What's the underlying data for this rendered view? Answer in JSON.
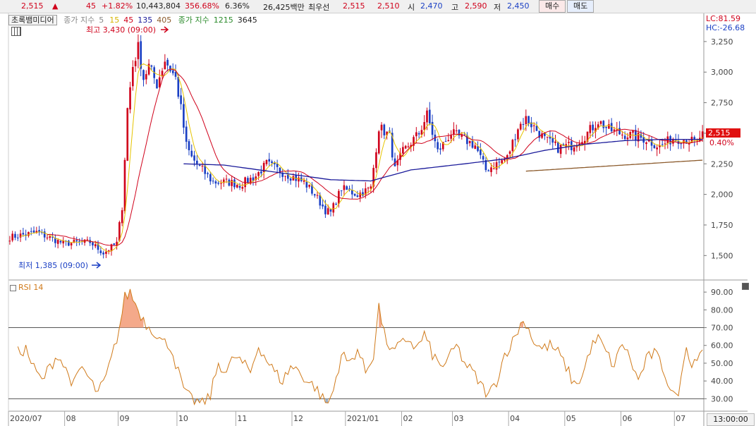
{
  "header": {
    "price": "2,515",
    "change_arrow": "▲",
    "change": "45",
    "change_pct": "+1.82%",
    "volume": "10,443,804",
    "vol_ratio": "356.68%",
    "turnover": "6.36%",
    "amount": "26,425백만",
    "best_bid_label": "최우선",
    "best_ask": "2,515",
    "best_bid": "2,510",
    "open_label": "시",
    "open": "2,470",
    "high_label": "고",
    "high": "2,590",
    "low_label": "저",
    "low": "2,450",
    "buy_button": "매수",
    "sell_button": "매도"
  },
  "legend": {
    "source": "초록뱀미디어",
    "ma_label": "종가 지수",
    "ma_periods": [
      "5",
      "15",
      "45",
      "135",
      "405"
    ],
    "ma2_label": "종가 지수",
    "ma2_periods": [
      "1215",
      "3645"
    ]
  },
  "side": {
    "lc": "LC:81.59",
    "hc": "HC:-26.68",
    "last_price": "2,515",
    "last_pct": "0.40%",
    "time": "13:00:00"
  },
  "annotations": {
    "high": "최고 3,430 (09:00)",
    "low": "최저 1,385 (09:00)"
  },
  "rsi_title": "RSI 14",
  "colors": {
    "up": "#d0021b",
    "down": "#1a3fc4",
    "ma5": "#e6c400",
    "ma15": "#d0021b",
    "ma45": "#1a1a9a",
    "ma135": "#8b5a2b",
    "rsi": "#d07a1a"
  },
  "chart_data": [
    {
      "type": "candlestick",
      "ylim": [
        1300,
        3480
      ],
      "yticks": [
        1500,
        1750,
        2000,
        2250,
        2500,
        2750,
        3000,
        3250
      ],
      "ytick_labels": [
        "1,500",
        "1,750",
        "2,000",
        "2,250",
        "2,500",
        "2,750",
        "3,000",
        "3,250"
      ],
      "x_labels": [
        "2020/07",
        "08",
        "09",
        "10",
        "11",
        "12",
        "2021/01",
        "02",
        "03",
        "04",
        "05",
        "06",
        "07"
      ],
      "x_label_positions": [
        0,
        21,
        41,
        63,
        85,
        106,
        126,
        147,
        166,
        187,
        208,
        229,
        249
      ],
      "n_bars": 260,
      "close_anchors": [
        [
          0,
          1650
        ],
        [
          10,
          1690
        ],
        [
          20,
          1600
        ],
        [
          30,
          1610
        ],
        [
          35,
          1520
        ],
        [
          40,
          1600
        ],
        [
          42,
          1900
        ],
        [
          44,
          2700
        ],
        [
          46,
          3050
        ],
        [
          48,
          3200
        ],
        [
          50,
          2950
        ],
        [
          52,
          3050
        ],
        [
          55,
          2900
        ],
        [
          58,
          3100
        ],
        [
          62,
          2950
        ],
        [
          64,
          2700
        ],
        [
          66,
          2400
        ],
        [
          68,
          2300
        ],
        [
          72,
          2200
        ],
        [
          76,
          2100
        ],
        [
          82,
          2100
        ],
        [
          86,
          2080
        ],
        [
          92,
          2150
        ],
        [
          96,
          2250
        ],
        [
          102,
          2180
        ],
        [
          110,
          2100
        ],
        [
          114,
          2000
        ],
        [
          118,
          1870
        ],
        [
          120,
          1850
        ],
        [
          124,
          2050
        ],
        [
          130,
          2000
        ],
        [
          135,
          2050
        ],
        [
          138,
          2550
        ],
        [
          142,
          2480
        ],
        [
          144,
          2200
        ],
        [
          147,
          2350
        ],
        [
          153,
          2500
        ],
        [
          156,
          2650
        ],
        [
          160,
          2350
        ],
        [
          165,
          2500
        ],
        [
          170,
          2450
        ],
        [
          174,
          2400
        ],
        [
          178,
          2200
        ],
        [
          182,
          2250
        ],
        [
          186,
          2300
        ],
        [
          190,
          2550
        ],
        [
          193,
          2620
        ],
        [
          196,
          2550
        ],
        [
          200,
          2450
        ],
        [
          205,
          2380
        ],
        [
          210,
          2400
        ],
        [
          215,
          2480
        ],
        [
          220,
          2600
        ],
        [
          224,
          2530
        ],
        [
          228,
          2500
        ],
        [
          233,
          2480
        ],
        [
          238,
          2450
        ],
        [
          243,
          2390
        ],
        [
          248,
          2460
        ],
        [
          253,
          2450
        ],
        [
          257,
          2420
        ],
        [
          259,
          2515
        ]
      ],
      "ma135_anchors": [
        [
          65,
          2250
        ],
        [
          80,
          2240
        ],
        [
          100,
          2180
        ],
        [
          120,
          2120
        ],
        [
          135,
          2110
        ],
        [
          150,
          2200
        ],
        [
          170,
          2250
        ],
        [
          185,
          2290
        ],
        [
          200,
          2360
        ],
        [
          215,
          2410
        ],
        [
          230,
          2440
        ],
        [
          245,
          2450
        ],
        [
          259,
          2450
        ]
      ],
      "ma405_anchors": [
        [
          193,
          2190
        ],
        [
          259,
          2280
        ]
      ],
      "series": [
        {
          "name": "5",
          "type": "line"
        },
        {
          "name": "15",
          "type": "line"
        },
        {
          "name": "45",
          "type": "line"
        },
        {
          "name": "135",
          "type": "line"
        },
        {
          "name": "405",
          "type": "line"
        }
      ]
    },
    {
      "type": "line",
      "ylim": [
        23,
        96
      ],
      "yticks": [
        30,
        40,
        50,
        60,
        70,
        80,
        90
      ],
      "ytick_labels": [
        "30.00",
        "40.00",
        "50.00",
        "60.00",
        "70.00",
        "80.00",
        "90.00"
      ],
      "overbought": 70,
      "oversold": 30,
      "series": [
        {
          "name": "RSI 14",
          "anchors": [
            [
              3,
              56
            ],
            [
              6,
              58
            ],
            [
              9,
              47
            ],
            [
              12,
              40
            ],
            [
              15,
              48
            ],
            [
              18,
              55
            ],
            [
              21,
              46
            ],
            [
              24,
              38
            ],
            [
              27,
              48
            ],
            [
              30,
              40
            ],
            [
              33,
              33
            ],
            [
              36,
              42
            ],
            [
              39,
              58
            ],
            [
              41,
              70
            ],
            [
              43,
              87
            ],
            [
              45,
              90
            ],
            [
              48,
              80
            ],
            [
              51,
              72
            ],
            [
              54,
              68
            ],
            [
              57,
              62
            ],
            [
              60,
              60
            ],
            [
              62,
              50
            ],
            [
              64,
              40
            ],
            [
              66,
              32
            ],
            [
              69,
              29
            ],
            [
              72,
              27
            ],
            [
              75,
              32
            ],
            [
              78,
              50
            ],
            [
              81,
              45
            ],
            [
              84,
              54
            ],
            [
              87,
              50
            ],
            [
              90,
              45
            ],
            [
              93,
              60
            ],
            [
              96,
              52
            ],
            [
              99,
              45
            ],
            [
              102,
              40
            ],
            [
              105,
              48
            ],
            [
              108,
              46
            ],
            [
              111,
              40
            ],
            [
              114,
              37
            ],
            [
              117,
              30
            ],
            [
              119,
              27
            ],
            [
              121,
              35
            ],
            [
              124,
              55
            ],
            [
              127,
              50
            ],
            [
              130,
              58
            ],
            [
              133,
              45
            ],
            [
              136,
              55
            ],
            [
              138,
              82
            ],
            [
              140,
              66
            ],
            [
              143,
              56
            ],
            [
              146,
              60
            ],
            [
              149,
              64
            ],
            [
              152,
              58
            ],
            [
              155,
              66
            ],
            [
              158,
              55
            ],
            [
              161,
              48
            ],
            [
              164,
              52
            ],
            [
              167,
              60
            ],
            [
              170,
              50
            ],
            [
              173,
              45
            ],
            [
              176,
              38
            ],
            [
              179,
              32
            ],
            [
              182,
              40
            ],
            [
              185,
              55
            ],
            [
              188,
              62
            ],
            [
              191,
              72
            ],
            [
              193,
              73
            ],
            [
              196,
              62
            ],
            [
              199,
              58
            ],
            [
              202,
              60
            ],
            [
              205,
              56
            ],
            [
              208,
              48
            ],
            [
              211,
              38
            ],
            [
              214,
              42
            ],
            [
              217,
              58
            ],
            [
              220,
              64
            ],
            [
              223,
              56
            ],
            [
              226,
              48
            ],
            [
              229,
              62
            ],
            [
              232,
              52
            ],
            [
              235,
              40
            ],
            [
              238,
              52
            ],
            [
              241,
              56
            ],
            [
              244,
              48
            ],
            [
              247,
              36
            ],
            [
              249,
              30
            ],
            [
              251,
              40
            ],
            [
              253,
              62
            ],
            [
              255,
              48
            ],
            [
              257,
              55
            ],
            [
              259,
              58
            ]
          ]
        }
      ]
    }
  ]
}
